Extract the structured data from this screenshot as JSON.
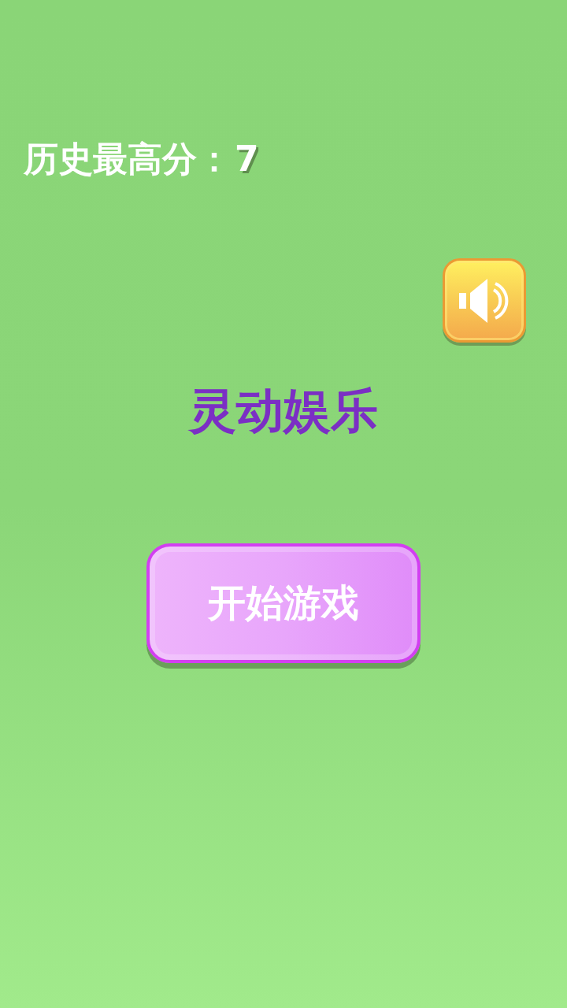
{
  "high_score": {
    "label": "历史最高分：",
    "value": "7"
  },
  "sound_button": {
    "on": true
  },
  "title": "灵动娱乐",
  "start_button": {
    "label": "开始游戏"
  }
}
